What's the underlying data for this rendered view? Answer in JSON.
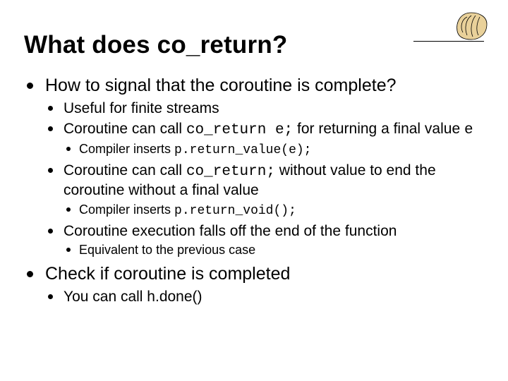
{
  "title": "What does co_return?",
  "bullets": {
    "a": "How to signal that the coroutine is complete?",
    "a1": "Useful for finite streams",
    "a2_pre": "Coroutine can call ",
    "a2_code": "co_return e;",
    "a2_post": " for returning a final value ",
    "a2_code2": "e",
    "a2a_pre": "Compiler inserts ",
    "a2a_code": "p.return_value(e);",
    "a3_pre": "Coroutine can call ",
    "a3_code": "co_return;",
    "a3_post": " without value to end the coroutine without a final value",
    "a3a_pre": "Compiler inserts ",
    "a3a_code": "p.return_void();",
    "a4": "Coroutine execution falls off the end of the function",
    "a4a": "Equivalent to the previous case",
    "b": "Check if coroutine is completed",
    "b1": "You can call h.done()"
  }
}
